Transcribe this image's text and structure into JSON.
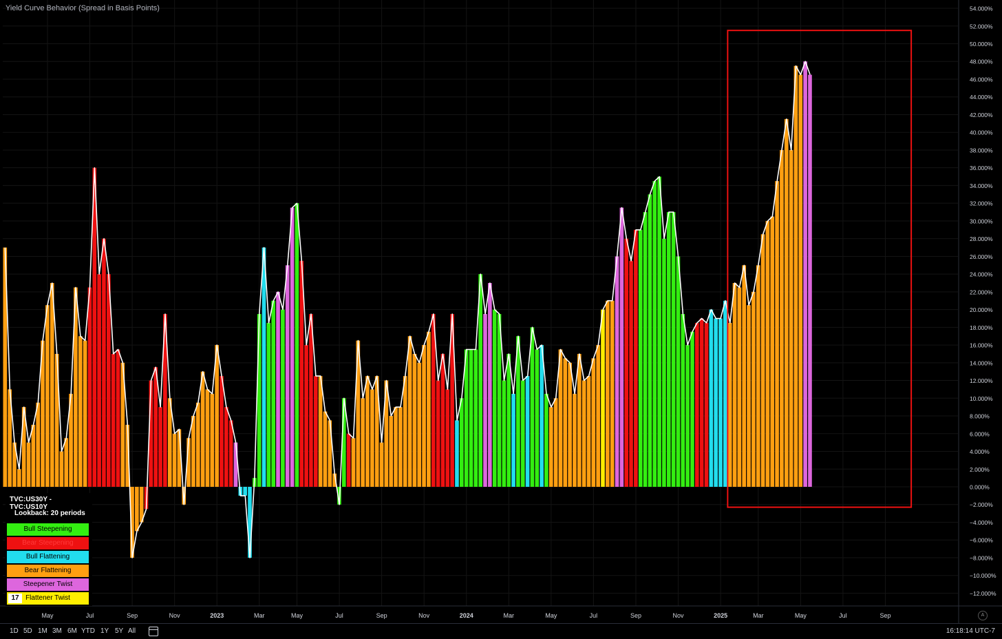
{
  "chart_data": {
    "type": "bar",
    "title": "Yield Curve Behavior (Spread in Basis Points)",
    "symbol": "TVC:US30Y - TVC:US10Y",
    "lookback": "Lookback: 20 periods",
    "ylim": [
      -13.5,
      55
    ],
    "y_ticks": [
      "54.000%",
      "52.000%",
      "50.000%",
      "48.000%",
      "46.000%",
      "44.000%",
      "42.000%",
      "40.000%",
      "38.000%",
      "36.000%",
      "34.000%",
      "32.000%",
      "30.000%",
      "28.000%",
      "26.000%",
      "24.000%",
      "22.000%",
      "20.000%",
      "18.000%",
      "16.000%",
      "14.000%",
      "12.000%",
      "10.000%",
      "8.000%",
      "6.000%",
      "4.000%",
      "2.000%",
      "0.000%",
      "−2.000%",
      "−4.000%",
      "−6.000%",
      "−8.000%",
      "−10.000%",
      "−12.000%"
    ],
    "y_tick_values": [
      54,
      52,
      50,
      48,
      46,
      44,
      42,
      40,
      38,
      36,
      34,
      32,
      30,
      28,
      26,
      24,
      22,
      20,
      18,
      16,
      14,
      12,
      10,
      8,
      6,
      4,
      2,
      0,
      -2,
      -4,
      -6,
      -8,
      -10,
      -12
    ],
    "x_ticks": [
      {
        "label": "May",
        "week": 9.5
      },
      {
        "label": "Jul",
        "week": 18.5
      },
      {
        "label": "Sep",
        "week": 27.5
      },
      {
        "label": "Nov",
        "week": 36.5
      },
      {
        "label": "2023",
        "week": 45.5
      },
      {
        "label": "Mar",
        "week": 54.5
      },
      {
        "label": "May",
        "week": 62.5
      },
      {
        "label": "Jul",
        "week": 71.5
      },
      {
        "label": "Sep",
        "week": 80.5
      },
      {
        "label": "Nov",
        "week": 89.5
      },
      {
        "label": "2024",
        "week": 98.5
      },
      {
        "label": "Mar",
        "week": 107.5
      },
      {
        "label": "May",
        "week": 116.5
      },
      {
        "label": "Jul",
        "week": 125.5
      },
      {
        "label": "Sep",
        "week": 134.5
      },
      {
        "label": "Nov",
        "week": 143.5
      },
      {
        "label": "2025",
        "week": 152.5
      },
      {
        "label": "Mar",
        "week": 160.5
      },
      {
        "label": "May",
        "week": 169.5
      },
      {
        "label": "Jul",
        "week": 178.5
      },
      {
        "label": "Sep",
        "week": 187.5
      }
    ],
    "categories_legend": [
      {
        "name": "Bull Steepening",
        "color": "#33ee11",
        "text_color": "#000000"
      },
      {
        "name": "Bear Steepening",
        "color": "#ee1111",
        "text_color": "#ff3b3b"
      },
      {
        "name": "Bull Flattening",
        "color": "#22ddee",
        "text_color": "#000000"
      },
      {
        "name": "Bear Flattening",
        "color": "#ff9f11",
        "text_color": "#000000"
      },
      {
        "name": "Steepener Twist",
        "color": "#dd66dd",
        "text_color": "#000000"
      },
      {
        "name": "Flattener Twist",
        "color": "#ffee00",
        "text_color": "#000000"
      }
    ],
    "series": {
      "values": [
        27,
        11,
        5,
        2,
        9,
        5,
        7,
        9.5,
        16.5,
        20.5,
        23,
        15,
        4,
        5.5,
        10.5,
        22.5,
        17,
        16.5,
        22.5,
        36,
        24,
        28,
        24,
        15,
        15.5,
        14,
        7,
        -8,
        -5,
        -4,
        -2.5,
        12,
        13.5,
        9,
        19.5,
        10,
        6,
        6.5,
        -2,
        5.5,
        8,
        9.5,
        13,
        11,
        10.5,
        16,
        12.5,
        9,
        7.5,
        5,
        -1,
        -1,
        -8,
        1,
        19.5,
        27,
        18.5,
        21,
        22,
        20,
        25,
        31.5,
        32,
        25.5,
        16,
        19.5,
        12.5,
        12.5,
        8.5,
        7.5,
        1.5,
        -2,
        10,
        6,
        5.5,
        16.5,
        10,
        12.5,
        11,
        12.5,
        5,
        12,
        8,
        9,
        9,
        12.5,
        17,
        15,
        14,
        16,
        17.5,
        19.5,
        12,
        15,
        11,
        19.5,
        7.5,
        10,
        15.5,
        15.5,
        15.5,
        24,
        19.5,
        23,
        20,
        19.5,
        12,
        15,
        10.5,
        17,
        12,
        12.5,
        18,
        15.5,
        16,
        10.5,
        9,
        10,
        15.5,
        14.5,
        14,
        10.5,
        15,
        12,
        12.5,
        14.5,
        16,
        20,
        21,
        21,
        26,
        31.5,
        28,
        25.5,
        29,
        29,
        31,
        33,
        34.5,
        35,
        28,
        31,
        31,
        26,
        19.5,
        16,
        17.5,
        18.5,
        19,
        18.5,
        20,
        19,
        19,
        21,
        18.5,
        23,
        22.5,
        25,
        20.5,
        22,
        25,
        28.5,
        30,
        30.5,
        34.5,
        38,
        41.5,
        38,
        47.5,
        46.5,
        48,
        46.5
      ],
      "colors": "OOOOOOOOOOOOOOOOOORRRRRRROOOOORRRRROOOOOOOOOOORRRPBBBGGBGGPGPPGRRRROOOOGGROOOOOOOOOOOOOOOOORRRRRBGGGGGPPGGGGBGGBGGBGOOOOOOOOOOOYOOPPRRRGGGGGGGGGGGGRRRBBBBOOOOOOOOOOOOOOOOPPRRRRP",
      "color_key": {
        "O": "#ff9f11",
        "R": "#ee1111",
        "G": "#33ee11",
        "B": "#22ddee",
        "P": "#dd66dd",
        "Y": "#ffee00"
      }
    },
    "annotation": {
      "type": "rectangle",
      "color": "#ee1111",
      "from_week": 154,
      "to_week": 193,
      "y_top": 51.5,
      "y_bottom": -2.3
    }
  },
  "toolbar": {
    "timeframes": [
      "1D",
      "5D",
      "1M",
      "3M",
      "6M",
      "YTD",
      "1Y",
      "5Y",
      "All"
    ],
    "clock": "16:18:14 UTC-7",
    "auto_label": "A"
  },
  "logo_text": "17"
}
